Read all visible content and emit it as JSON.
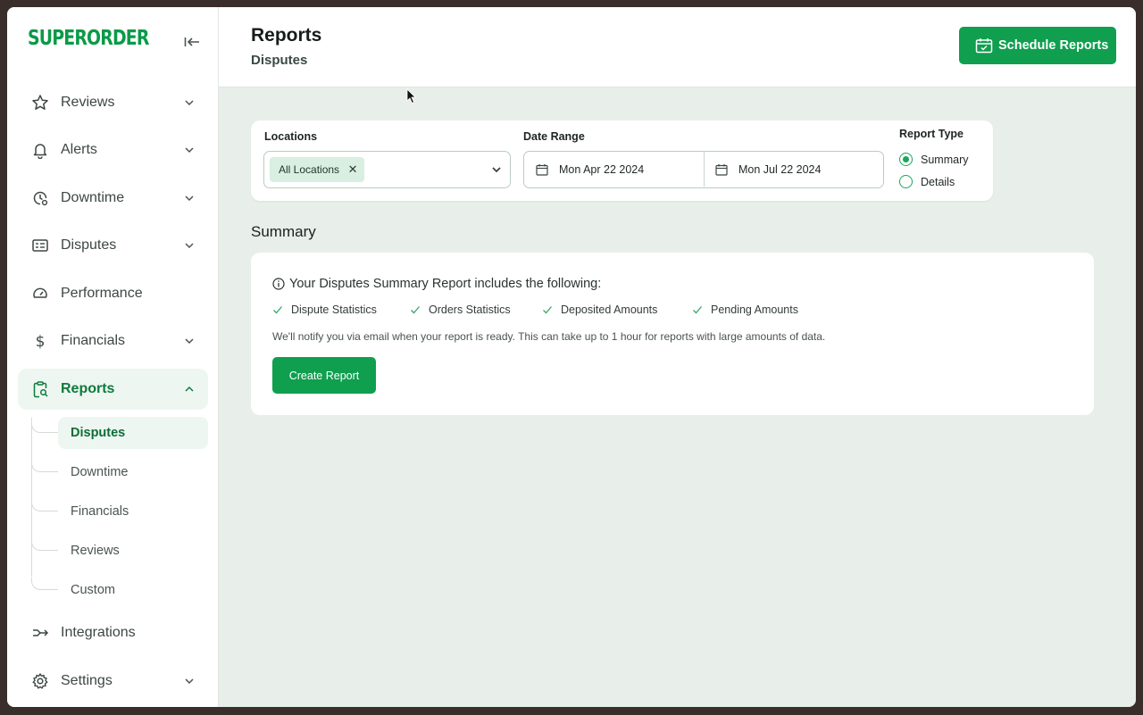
{
  "brand": {
    "logo_text": "SUPERORDER",
    "accent": "#0f9f4f"
  },
  "sidebar": {
    "items": [
      {
        "label": "Reviews",
        "icon": "star-icon",
        "has_chevron": true
      },
      {
        "label": "Alerts",
        "icon": "bell-icon",
        "has_chevron": true
      },
      {
        "label": "Downtime",
        "icon": "clock-icon",
        "has_chevron": true
      },
      {
        "label": "Disputes",
        "icon": "id-card-icon",
        "has_chevron": true
      },
      {
        "label": "Performance",
        "icon": "gauge-icon",
        "has_chevron": false
      },
      {
        "label": "Financials",
        "icon": "dollar-icon",
        "has_chevron": true
      },
      {
        "label": "Reports",
        "icon": "clipboard-search-icon",
        "has_chevron": true,
        "expanded": true
      },
      {
        "label": "Integrations",
        "icon": "integrations-arrow-icon",
        "has_chevron": false
      },
      {
        "label": "Settings",
        "icon": "gear-icon",
        "has_chevron": true
      }
    ],
    "reports_subitems": [
      {
        "label": "Disputes",
        "active": true
      },
      {
        "label": "Downtime"
      },
      {
        "label": "Financials"
      },
      {
        "label": "Reviews"
      },
      {
        "label": "Custom"
      }
    ]
  },
  "header": {
    "title": "Reports",
    "subtitle": "Disputes",
    "schedule_button": "Schedule Reports"
  },
  "filters": {
    "locations_label": "Locations",
    "locations_chip": "All Locations",
    "date_range_label": "Date Range",
    "date_start": "Mon Apr 22 2024",
    "date_end": "Mon Jul 22 2024",
    "report_type_label": "Report Type",
    "report_types": [
      {
        "label": "Summary",
        "selected": true
      },
      {
        "label": "Details",
        "selected": false
      }
    ]
  },
  "summary": {
    "heading": "Summary",
    "card_title": "Your Disputes Summary Report includes the following:",
    "includes": [
      "Dispute Statistics",
      "Orders Statistics",
      "Deposited Amounts",
      "Pending Amounts"
    ],
    "note": "We'll notify you via email when your report is ready. This can take up to 1 hour for reports with large amounts of data.",
    "create_button": "Create Report"
  }
}
